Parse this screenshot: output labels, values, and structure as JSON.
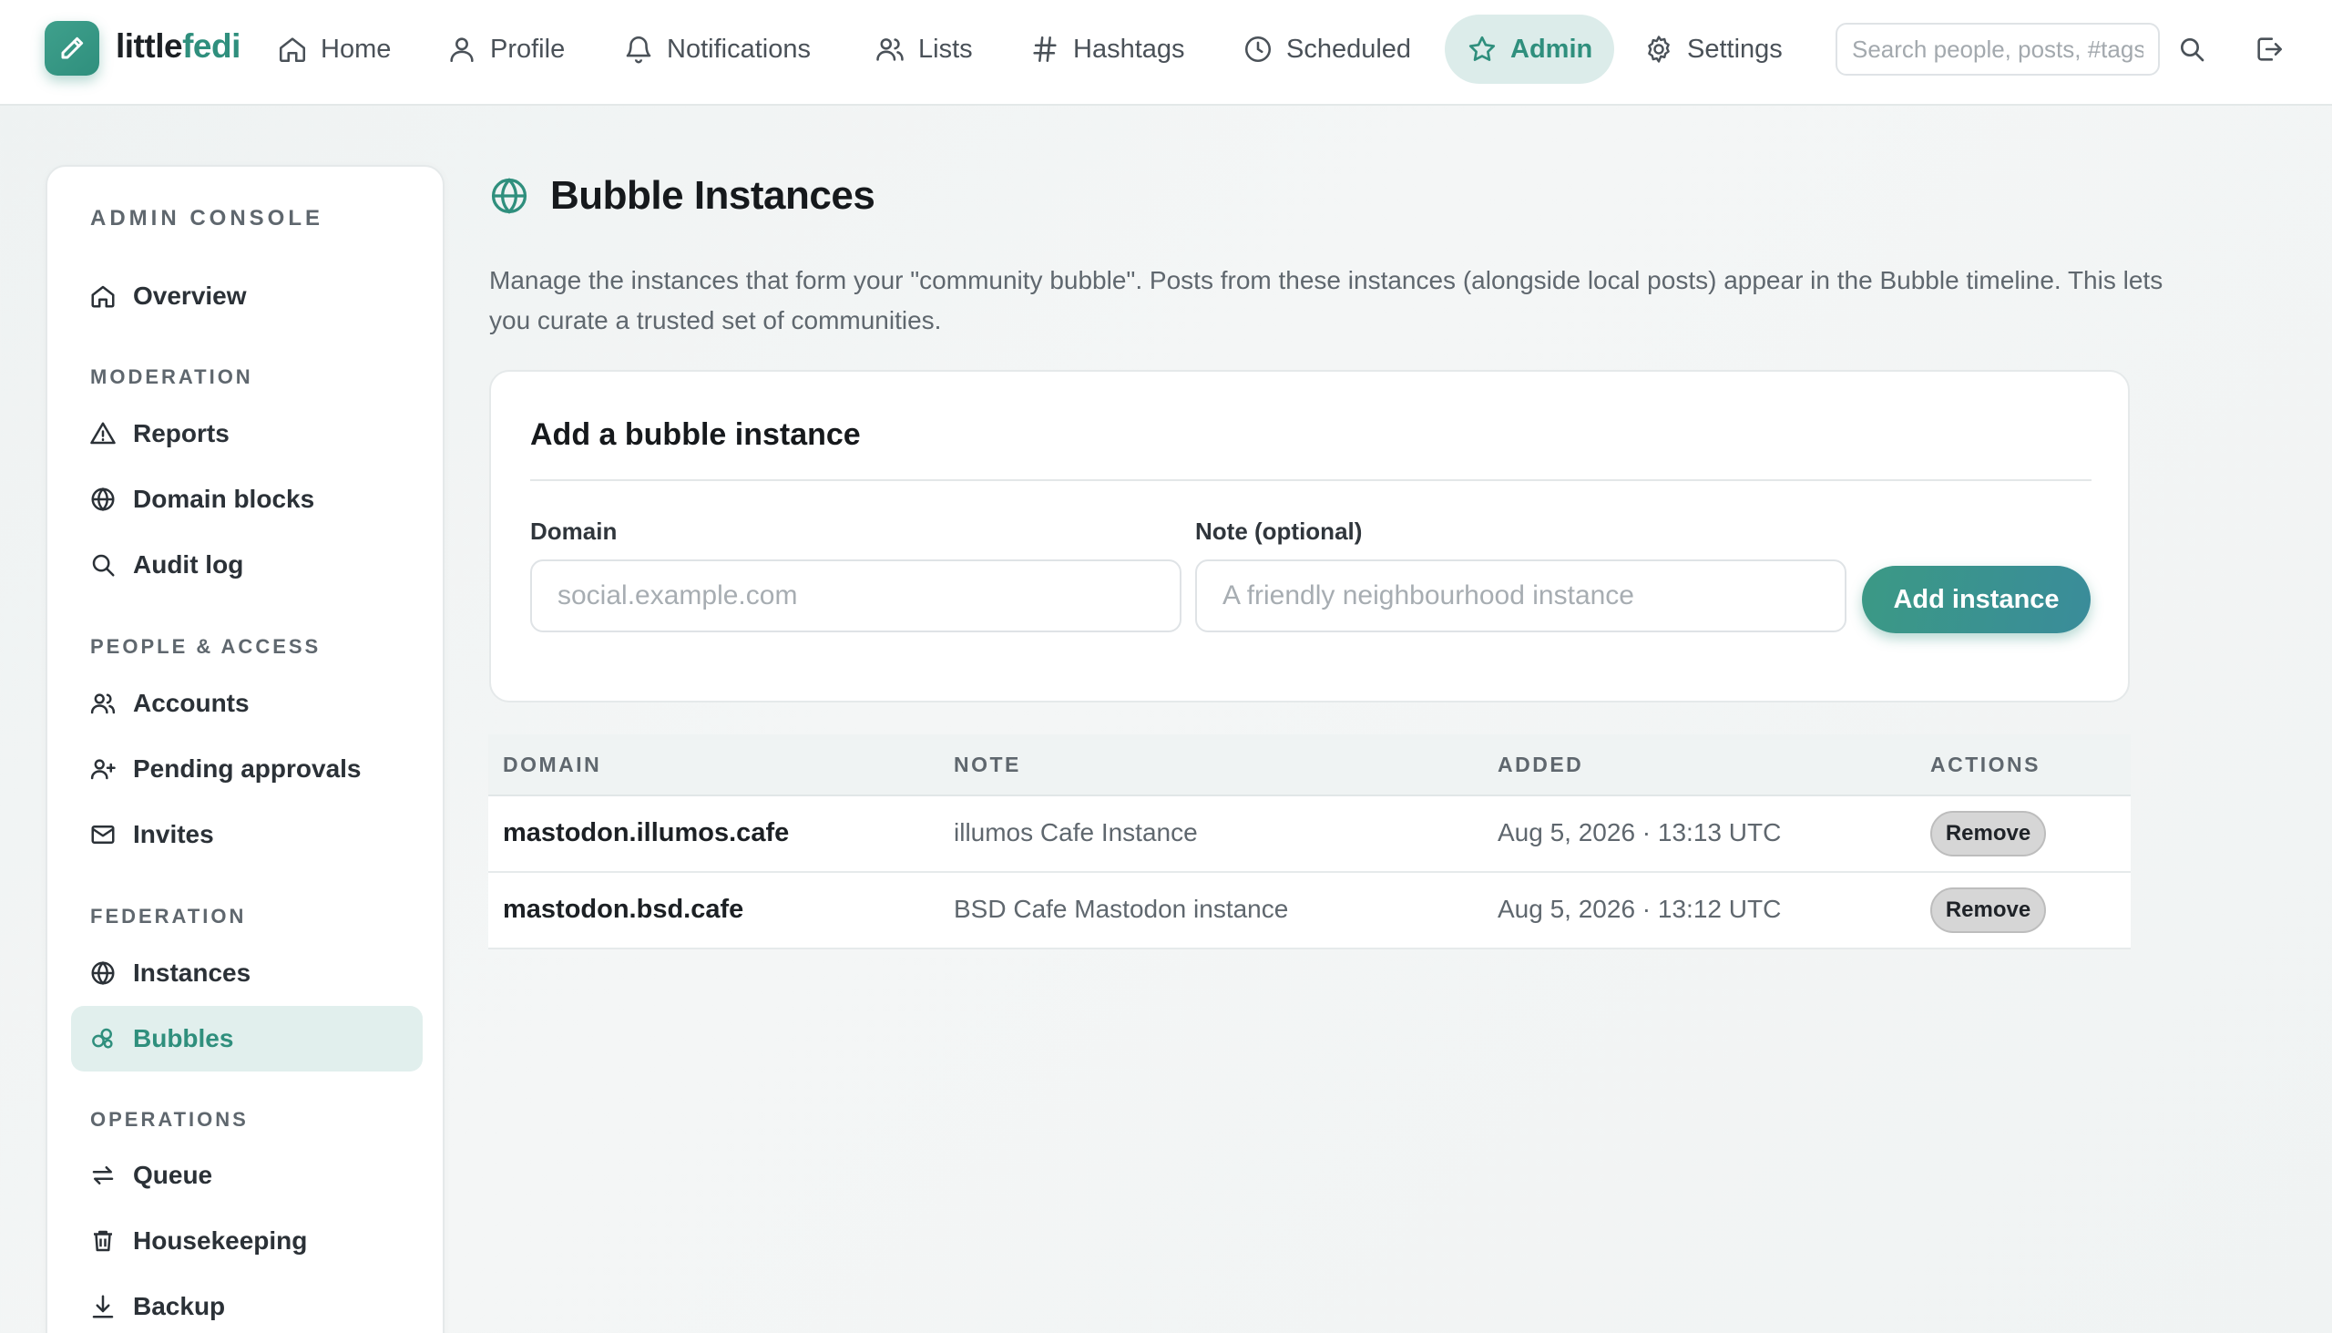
{
  "brand": {
    "prefix": "little",
    "accent": "fedi",
    "logo_icon": "pencil-icon"
  },
  "nav": {
    "items": [
      {
        "label": "Home",
        "icon": "home-icon"
      },
      {
        "label": "Profile",
        "icon": "user-icon"
      },
      {
        "label": "Notifications",
        "icon": "bell-icon"
      },
      {
        "label": "Lists",
        "icon": "users-icon"
      },
      {
        "label": "Hashtags",
        "icon": "hash-icon"
      },
      {
        "label": "Scheduled",
        "icon": "clock-icon"
      },
      {
        "label": "Admin",
        "icon": "star-icon",
        "active": true
      },
      {
        "label": "Settings",
        "icon": "gear-icon"
      }
    ],
    "search_placeholder": "Search people, posts, #tags"
  },
  "sidebar": {
    "title": "ADMIN CONSOLE",
    "overview": "Overview",
    "sections": {
      "moderation": {
        "title": "MODERATION",
        "items": [
          "Reports",
          "Domain blocks",
          "Audit log"
        ]
      },
      "people": {
        "title": "PEOPLE & ACCESS",
        "items": [
          "Accounts",
          "Pending approvals",
          "Invites"
        ]
      },
      "federation": {
        "title": "FEDERATION",
        "items": [
          "Instances",
          "Bubbles"
        ]
      },
      "operations": {
        "title": "OPERATIONS",
        "items": [
          "Queue",
          "Housekeeping",
          "Backup"
        ]
      }
    },
    "active_item": "Bubbles"
  },
  "main": {
    "title": "Bubble Instances",
    "description": "Manage the instances that form your \"community bubble\". Posts from these instances (alongside local posts) appear in the Bubble timeline. This lets you curate a trusted set of communities.",
    "form": {
      "title": "Add a bubble instance",
      "domain_label": "Domain",
      "domain_placeholder": "social.example.com",
      "note_label": "Note (optional)",
      "note_placeholder": "A friendly neighbourhood instance",
      "submit_label": "Add instance"
    },
    "table": {
      "headers": [
        "DOMAIN",
        "NOTE",
        "ADDED",
        "ACTIONS"
      ],
      "rows": [
        {
          "domain": "mastodon.illumos.cafe",
          "note": "illumos Cafe Instance",
          "added": "Aug 5, 2026 · 13:13 UTC",
          "action": "Remove"
        },
        {
          "domain": "mastodon.bsd.cafe",
          "note": "BSD Cafe Mastodon instance",
          "added": "Aug 5, 2026 · 13:12 UTC",
          "action": "Remove"
        }
      ]
    }
  },
  "colors": {
    "accent": "#2f8f7d",
    "active_bg": "#dcecea",
    "text": "#1f2328",
    "muted": "#5f676e"
  }
}
